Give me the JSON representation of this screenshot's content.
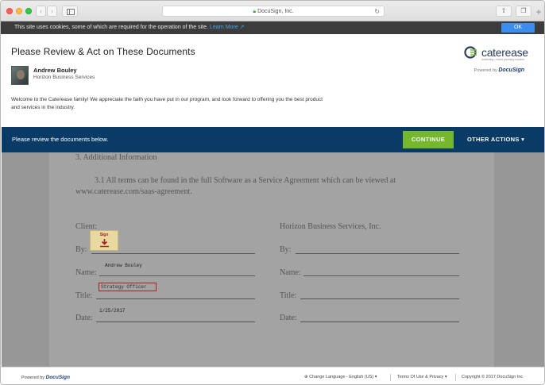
{
  "browser": {
    "address": "DocuSign, Inc.",
    "back_icon": "chevron-left",
    "forward_icon": "chevron-right"
  },
  "cookie_bar": {
    "text": "This site uses cookies, some of which are required for the operation of the site.",
    "link": "Learn More",
    "ok_label": "OK"
  },
  "header": {
    "title": "Please Review & Act on These Documents",
    "sender_name": "Andrew Bouley",
    "sender_company": "Horizon Business Services",
    "welcome": "Welcome to the Caterease family!  We appreciate the faith you have put in our program, and look forward to offering you the best product and services in the industry.",
    "logo_word": "caterease",
    "logo_tagline": "marketing • event planning solution",
    "powered_by": "Powered by",
    "powered_brand": "DocuSign"
  },
  "action_bar": {
    "message": "Please review the documents below.",
    "continue_label": "CONTINUE",
    "other_actions_label": "OTHER ACTIONS"
  },
  "document": {
    "section_heading": "3.     Additional Information",
    "clause_line1": "3.1      All terms can be found in the full Software as a Service Agreement which can be viewed at",
    "clause_line2": "www.caterease.com/saas-agreement.",
    "client_label": "Client:",
    "company_label": "Horizon Business Services, Inc.",
    "by_label": "By:",
    "name_label": "Name:",
    "title_label": "Title:",
    "date_label": "Date:",
    "sign_tag": "Sign",
    "name_value": "Andrew Bouley",
    "title_value": "Strategy Officer",
    "date_value": "1/25/2017"
  },
  "footer": {
    "powered_by": "Powered by",
    "powered_brand": "DocuSign",
    "language": "Change Language - English (US)",
    "terms": "Terms Of Use & Privacy",
    "copyright": "Copyright © 2017 DocuSign Inc."
  }
}
